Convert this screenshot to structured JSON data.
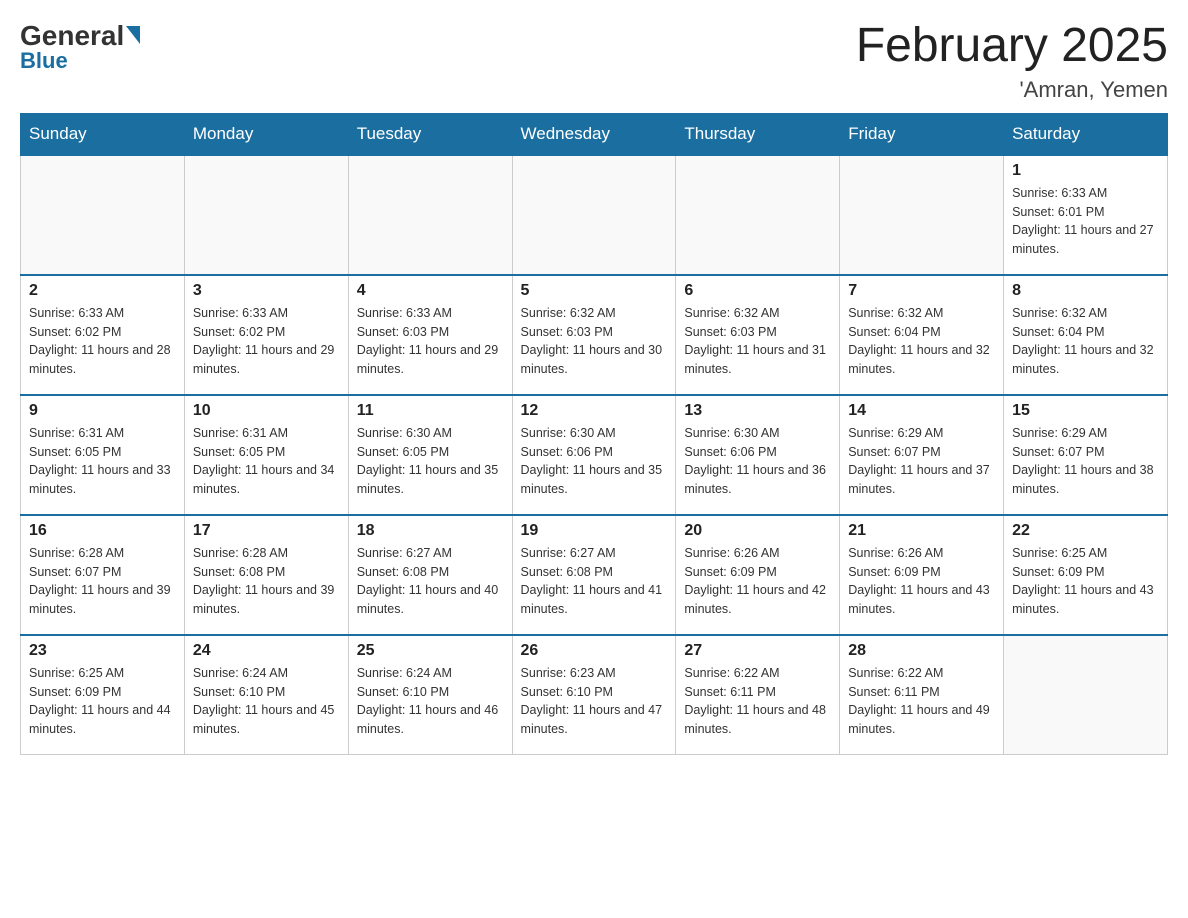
{
  "header": {
    "logo_general": "General",
    "logo_blue": "Blue",
    "month_title": "February 2025",
    "location": "'Amran, Yemen"
  },
  "days_of_week": [
    "Sunday",
    "Monday",
    "Tuesday",
    "Wednesday",
    "Thursday",
    "Friday",
    "Saturday"
  ],
  "weeks": [
    [
      {
        "day": "",
        "sunrise": "",
        "sunset": "",
        "daylight": "",
        "empty": true
      },
      {
        "day": "",
        "sunrise": "",
        "sunset": "",
        "daylight": "",
        "empty": true
      },
      {
        "day": "",
        "sunrise": "",
        "sunset": "",
        "daylight": "",
        "empty": true
      },
      {
        "day": "",
        "sunrise": "",
        "sunset": "",
        "daylight": "",
        "empty": true
      },
      {
        "day": "",
        "sunrise": "",
        "sunset": "",
        "daylight": "",
        "empty": true
      },
      {
        "day": "",
        "sunrise": "",
        "sunset": "",
        "daylight": "",
        "empty": true
      },
      {
        "day": "1",
        "sunrise": "Sunrise: 6:33 AM",
        "sunset": "Sunset: 6:01 PM",
        "daylight": "Daylight: 11 hours and 27 minutes.",
        "empty": false
      }
    ],
    [
      {
        "day": "2",
        "sunrise": "Sunrise: 6:33 AM",
        "sunset": "Sunset: 6:02 PM",
        "daylight": "Daylight: 11 hours and 28 minutes.",
        "empty": false
      },
      {
        "day": "3",
        "sunrise": "Sunrise: 6:33 AM",
        "sunset": "Sunset: 6:02 PM",
        "daylight": "Daylight: 11 hours and 29 minutes.",
        "empty": false
      },
      {
        "day": "4",
        "sunrise": "Sunrise: 6:33 AM",
        "sunset": "Sunset: 6:03 PM",
        "daylight": "Daylight: 11 hours and 29 minutes.",
        "empty": false
      },
      {
        "day": "5",
        "sunrise": "Sunrise: 6:32 AM",
        "sunset": "Sunset: 6:03 PM",
        "daylight": "Daylight: 11 hours and 30 minutes.",
        "empty": false
      },
      {
        "day": "6",
        "sunrise": "Sunrise: 6:32 AM",
        "sunset": "Sunset: 6:03 PM",
        "daylight": "Daylight: 11 hours and 31 minutes.",
        "empty": false
      },
      {
        "day": "7",
        "sunrise": "Sunrise: 6:32 AM",
        "sunset": "Sunset: 6:04 PM",
        "daylight": "Daylight: 11 hours and 32 minutes.",
        "empty": false
      },
      {
        "day": "8",
        "sunrise": "Sunrise: 6:32 AM",
        "sunset": "Sunset: 6:04 PM",
        "daylight": "Daylight: 11 hours and 32 minutes.",
        "empty": false
      }
    ],
    [
      {
        "day": "9",
        "sunrise": "Sunrise: 6:31 AM",
        "sunset": "Sunset: 6:05 PM",
        "daylight": "Daylight: 11 hours and 33 minutes.",
        "empty": false
      },
      {
        "day": "10",
        "sunrise": "Sunrise: 6:31 AM",
        "sunset": "Sunset: 6:05 PM",
        "daylight": "Daylight: 11 hours and 34 minutes.",
        "empty": false
      },
      {
        "day": "11",
        "sunrise": "Sunrise: 6:30 AM",
        "sunset": "Sunset: 6:05 PM",
        "daylight": "Daylight: 11 hours and 35 minutes.",
        "empty": false
      },
      {
        "day": "12",
        "sunrise": "Sunrise: 6:30 AM",
        "sunset": "Sunset: 6:06 PM",
        "daylight": "Daylight: 11 hours and 35 minutes.",
        "empty": false
      },
      {
        "day": "13",
        "sunrise": "Sunrise: 6:30 AM",
        "sunset": "Sunset: 6:06 PM",
        "daylight": "Daylight: 11 hours and 36 minutes.",
        "empty": false
      },
      {
        "day": "14",
        "sunrise": "Sunrise: 6:29 AM",
        "sunset": "Sunset: 6:07 PM",
        "daylight": "Daylight: 11 hours and 37 minutes.",
        "empty": false
      },
      {
        "day": "15",
        "sunrise": "Sunrise: 6:29 AM",
        "sunset": "Sunset: 6:07 PM",
        "daylight": "Daylight: 11 hours and 38 minutes.",
        "empty": false
      }
    ],
    [
      {
        "day": "16",
        "sunrise": "Sunrise: 6:28 AM",
        "sunset": "Sunset: 6:07 PM",
        "daylight": "Daylight: 11 hours and 39 minutes.",
        "empty": false
      },
      {
        "day": "17",
        "sunrise": "Sunrise: 6:28 AM",
        "sunset": "Sunset: 6:08 PM",
        "daylight": "Daylight: 11 hours and 39 minutes.",
        "empty": false
      },
      {
        "day": "18",
        "sunrise": "Sunrise: 6:27 AM",
        "sunset": "Sunset: 6:08 PM",
        "daylight": "Daylight: 11 hours and 40 minutes.",
        "empty": false
      },
      {
        "day": "19",
        "sunrise": "Sunrise: 6:27 AM",
        "sunset": "Sunset: 6:08 PM",
        "daylight": "Daylight: 11 hours and 41 minutes.",
        "empty": false
      },
      {
        "day": "20",
        "sunrise": "Sunrise: 6:26 AM",
        "sunset": "Sunset: 6:09 PM",
        "daylight": "Daylight: 11 hours and 42 minutes.",
        "empty": false
      },
      {
        "day": "21",
        "sunrise": "Sunrise: 6:26 AM",
        "sunset": "Sunset: 6:09 PM",
        "daylight": "Daylight: 11 hours and 43 minutes.",
        "empty": false
      },
      {
        "day": "22",
        "sunrise": "Sunrise: 6:25 AM",
        "sunset": "Sunset: 6:09 PM",
        "daylight": "Daylight: 11 hours and 43 minutes.",
        "empty": false
      }
    ],
    [
      {
        "day": "23",
        "sunrise": "Sunrise: 6:25 AM",
        "sunset": "Sunset: 6:09 PM",
        "daylight": "Daylight: 11 hours and 44 minutes.",
        "empty": false
      },
      {
        "day": "24",
        "sunrise": "Sunrise: 6:24 AM",
        "sunset": "Sunset: 6:10 PM",
        "daylight": "Daylight: 11 hours and 45 minutes.",
        "empty": false
      },
      {
        "day": "25",
        "sunrise": "Sunrise: 6:24 AM",
        "sunset": "Sunset: 6:10 PM",
        "daylight": "Daylight: 11 hours and 46 minutes.",
        "empty": false
      },
      {
        "day": "26",
        "sunrise": "Sunrise: 6:23 AM",
        "sunset": "Sunset: 6:10 PM",
        "daylight": "Daylight: 11 hours and 47 minutes.",
        "empty": false
      },
      {
        "day": "27",
        "sunrise": "Sunrise: 6:22 AM",
        "sunset": "Sunset: 6:11 PM",
        "daylight": "Daylight: 11 hours and 48 minutes.",
        "empty": false
      },
      {
        "day": "28",
        "sunrise": "Sunrise: 6:22 AM",
        "sunset": "Sunset: 6:11 PM",
        "daylight": "Daylight: 11 hours and 49 minutes.",
        "empty": false
      },
      {
        "day": "",
        "sunrise": "",
        "sunset": "",
        "daylight": "",
        "empty": true
      }
    ]
  ]
}
